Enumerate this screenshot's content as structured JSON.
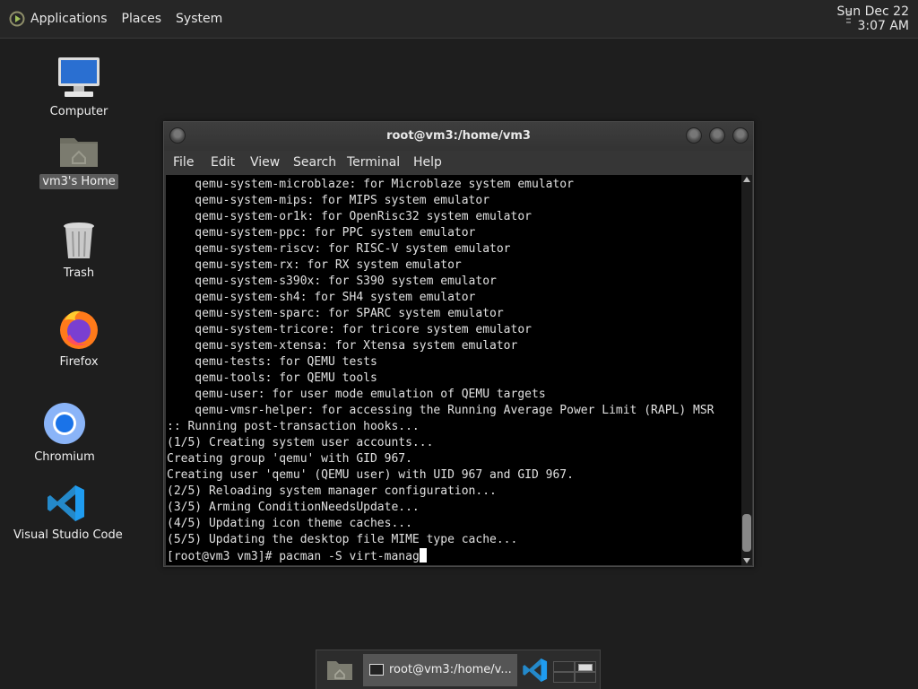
{
  "top_panel": {
    "menus": [
      "Applications",
      "Places",
      "System"
    ],
    "clock": {
      "date": "Sun Dec 22",
      "time": "3:07 AM"
    }
  },
  "desktop_icons": [
    {
      "label": "Computer",
      "icon": "computer-icon"
    },
    {
      "label": "vm3's Home",
      "icon": "home-folder-icon",
      "selected": true
    },
    {
      "label": "Trash",
      "icon": "trash-icon"
    },
    {
      "label": "Firefox",
      "icon": "firefox-icon"
    },
    {
      "label": "Chromium",
      "icon": "chromium-icon"
    },
    {
      "label": "Visual Studio Code",
      "icon": "vscode-icon"
    }
  ],
  "terminal": {
    "title": "root@vm3:/home/vm3",
    "menu": [
      "File",
      "Edit",
      "View",
      "Search",
      "Terminal",
      "Help"
    ],
    "lines": [
      "    qemu-system-microblaze: for Microblaze system emulator",
      "    qemu-system-mips: for MIPS system emulator",
      "    qemu-system-or1k: for OpenRisc32 system emulator",
      "    qemu-system-ppc: for PPC system emulator",
      "    qemu-system-riscv: for RISC-V system emulator",
      "    qemu-system-rx: for RX system emulator",
      "    qemu-system-s390x: for S390 system emulator",
      "    qemu-system-sh4: for SH4 system emulator",
      "    qemu-system-sparc: for SPARC system emulator",
      "    qemu-system-tricore: for tricore system emulator",
      "    qemu-system-xtensa: for Xtensa system emulator",
      "    qemu-tests: for QEMU tests",
      "    qemu-tools: for QEMU tools",
      "    qemu-user: for user mode emulation of QEMU targets",
      "    qemu-vmsr-helper: for accessing the Running Average Power Limit (RAPL) MSR",
      ":: Running post-transaction hooks...",
      "(1/5) Creating system user accounts...",
      "Creating group 'qemu' with GID 967.",
      "Creating user 'qemu' (QEMU user) with UID 967 and GID 967.",
      "(2/5) Reloading system manager configuration...",
      "(3/5) Arming ConditionNeedsUpdate...",
      "(4/5) Updating icon theme caches...",
      "(5/5) Updating the desktop file MIME type cache..."
    ],
    "prompt": "[root@vm3 vm3]# ",
    "input": "pacman -S virt-manag"
  },
  "taskbar": {
    "items": [
      {
        "icon": "file-manager-icon"
      },
      {
        "icon": "terminal-icon",
        "label": "root@vm3:/home/v..."
      },
      {
        "icon": "vscode-icon"
      }
    ]
  }
}
